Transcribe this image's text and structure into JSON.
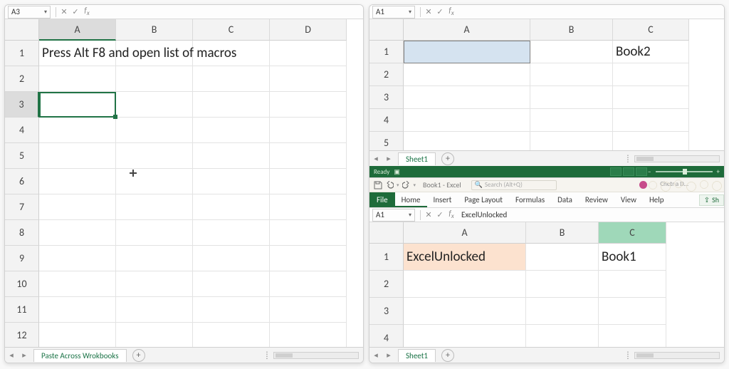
{
  "left": {
    "name_box": "A3",
    "formula_bar": "",
    "selected_cell": "A3",
    "col_headers": [
      "A",
      "B",
      "C",
      "D"
    ],
    "selected_col": "A",
    "rows": 12,
    "selected_row": 3,
    "cells": {
      "A1": "Press Alt F8 and open list of  macros"
    },
    "sheet_tab": "Paste Across Wrokbooks",
    "status_text": ""
  },
  "right_top": {
    "name_box": "A1",
    "formula_bar": "",
    "selected_cell": "A1",
    "col_headers": [
      "A",
      "B",
      "C"
    ],
    "rows": 5,
    "cells": {
      "C1": "Book2"
    },
    "sheet_tab": "Sheet1",
    "status_text": "Ready"
  },
  "right_bottom": {
    "titlebar": {
      "doc_title": "Book1 - Excel",
      "search_placeholder": "Search (Alt+Q)",
      "user_name": "Chetna D…"
    },
    "ribbon": {
      "file_label": "File",
      "tabs": [
        "Home",
        "Insert",
        "Page Layout",
        "Formulas",
        "Data",
        "Review",
        "View",
        "Help"
      ],
      "active_tab": "Home",
      "share_label": "Sh"
    },
    "name_box": "A1",
    "formula_bar": "ExcelUnlocked",
    "selected_cell": "A1",
    "highlight_cell": "C1",
    "col_headers": [
      "A",
      "B",
      "C"
    ],
    "rows": 4,
    "cells": {
      "A1": "ExcelUnlocked",
      "C1": "Book1"
    },
    "a1_bg": "#fce2cf",
    "c_hdr_bg": "#9fd8b9",
    "sheet_tab": "Sheet1"
  }
}
